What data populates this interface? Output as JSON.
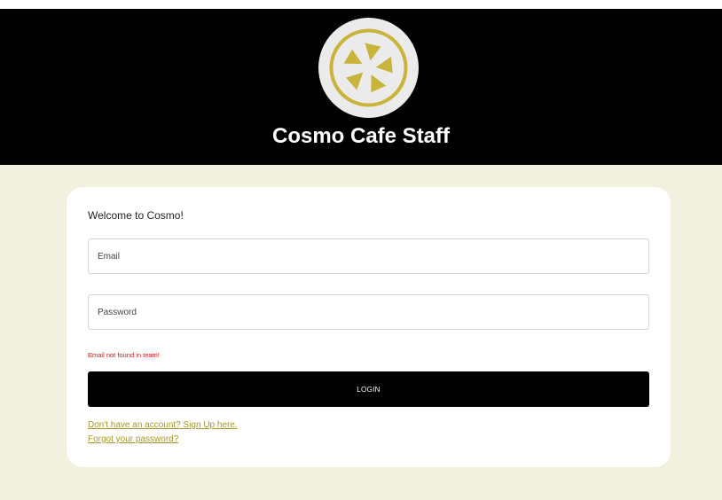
{
  "header": {
    "title": "Cosmo Cafe Staff",
    "logo_icon": "cosmo-star-logo",
    "background": "#000000",
    "accent": "#c8b43a"
  },
  "form": {
    "welcome": "Welcome to Cosmo!",
    "email_placeholder": "Email",
    "password_placeholder": "Password",
    "error": "Email not found in team!",
    "login_label": "LOGIN",
    "signup_link": "Don't have an account? Sign Up here.",
    "forgot_link": "Forgot your password?"
  },
  "colors": {
    "page_background": "#f2f0de",
    "error": "#e01010",
    "link": "#a6962a"
  }
}
